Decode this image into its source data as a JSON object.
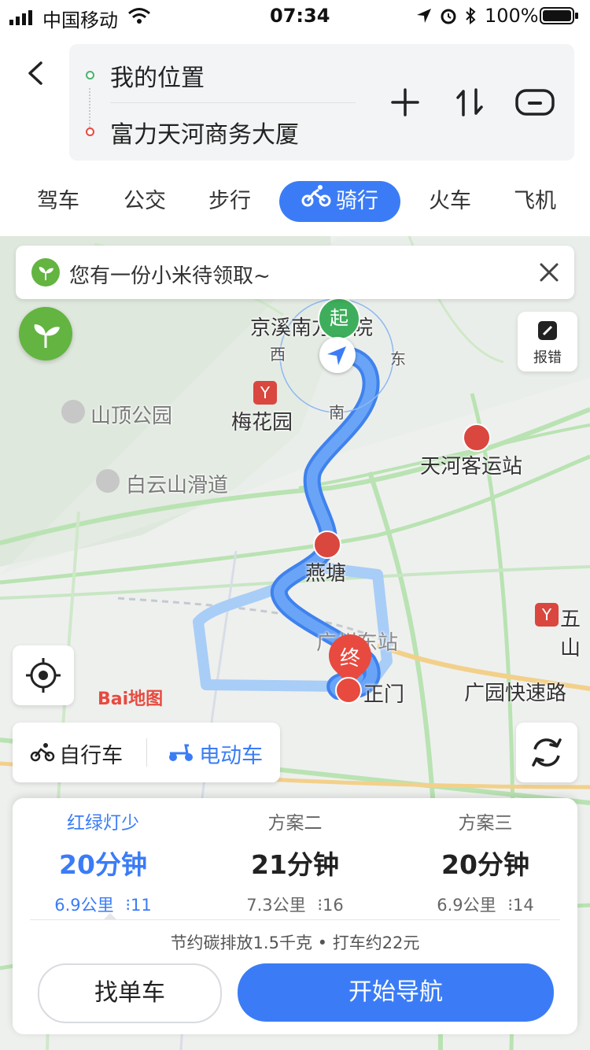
{
  "status_bar": {
    "carrier": "中国移动",
    "time": "07:34",
    "battery": "100%"
  },
  "header": {
    "origin": "我的位置",
    "destination": "富力天河商务大厦",
    "icons": [
      "back-arrow-icon",
      "plus-icon",
      "swap-icon",
      "camera-icon"
    ]
  },
  "tabs": [
    {
      "label": "驾车"
    },
    {
      "label": "公交"
    },
    {
      "label": "步行"
    },
    {
      "label": "骑行",
      "active": true
    },
    {
      "label": "火车"
    },
    {
      "label": "飞机"
    }
  ],
  "banner": {
    "text": "您有一份小米待领取~"
  },
  "map": {
    "labels": {
      "jingxi": "京溪南方医院",
      "meihuayuan": "梅花园",
      "shanding": "山顶公园",
      "baiyun": "白云山滑道",
      "tianhe_station": "天河客运站",
      "yantang": "燕塘",
      "guangzhou_east": "广州东站",
      "zhengmen": "正门",
      "guangyuan": "广园快速路",
      "wushan": "五山",
      "start": "起",
      "end": "终",
      "west": "西",
      "east": "东",
      "south": "南"
    },
    "report": "报错",
    "logo": "Bai地图",
    "colors": {
      "route": "#4a8cf5",
      "route_alt": "#a8cdf7",
      "accent": "#3b7cf6",
      "metro": "#d9473f",
      "start": "#3fae5c",
      "end": "#e84a3f"
    }
  },
  "vehicle_toggle": {
    "bike": "自行车",
    "ebike": "电动车"
  },
  "plans": [
    {
      "title": "红绿灯少",
      "time": "20分钟",
      "distance": "6.9公里",
      "lights": "11",
      "selected": true
    },
    {
      "title": "方案二",
      "time": "21分钟",
      "distance": "7.3公里",
      "lights": "16"
    },
    {
      "title": "方案三",
      "time": "20分钟",
      "distance": "6.9公里",
      "lights": "14"
    }
  ],
  "summary": "节约碳排放1.5千克 • 打车约22元",
  "buttons": {
    "find_bike": "找单车",
    "start_nav": "开始导航"
  }
}
